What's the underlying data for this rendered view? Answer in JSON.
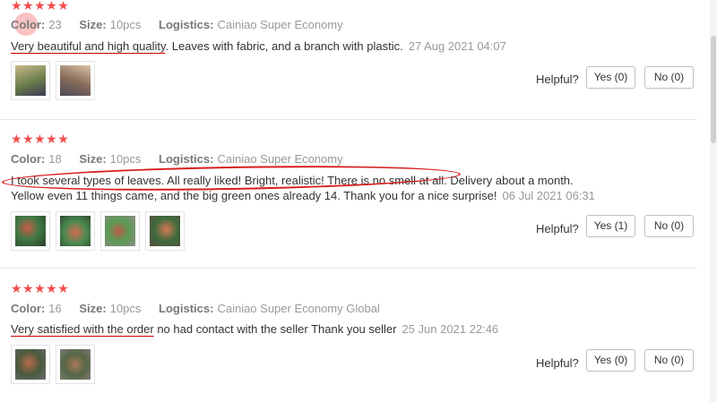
{
  "reviews": [
    {
      "stars": "★★★★★",
      "color_label": "Color:",
      "color_value": "23",
      "size_label": "Size:",
      "size_value": "10pcs",
      "logistics_label": "Logistics:",
      "logistics_value": "Cainiao Super Economy",
      "text_underlined": "Very beautiful and high quality",
      "text_rest": ". Leaves with fabric, and a branch with plastic.",
      "date": "27 Aug 2021 04:07",
      "photo_count": 2,
      "helpful_label": "Helpful?",
      "yes_label": "Yes (0)",
      "no_label": "No (0)"
    },
    {
      "stars": "★★★★★",
      "color_label": "Color:",
      "color_value": "18",
      "size_label": "Size:",
      "size_value": "10pcs",
      "logistics_label": "Logistics:",
      "logistics_value": "Cainiao Super Economy",
      "text": "I took several types of leaves. All really liked! Bright, realistic! There is no smell at all. Delivery about a month. Yellow even 11 things came, and the big green ones already 14. Thank you for a nice surprise!",
      "date": "06 Jul 2021 06:31",
      "photo_count": 4,
      "helpful_label": "Helpful?",
      "yes_label": "Yes (1)",
      "no_label": "No (0)"
    },
    {
      "stars": "★★★★★",
      "color_label": "Color:",
      "color_value": "16",
      "size_label": "Size:",
      "size_value": "10pcs",
      "logistics_label": "Logistics:",
      "logistics_value": "Cainiao Super Economy Global",
      "text_underlined": "Very satisfied with the order",
      "text_rest": " no had contact with the seller Thank you seller",
      "date": "25 Jun 2021 22:46",
      "photo_count": 2,
      "helpful_label": "Helpful?",
      "yes_label": "Yes (0)",
      "no_label": "No (0)"
    }
  ],
  "colors": {
    "star": "#f24c4c",
    "annotation": "#d81e1e"
  }
}
